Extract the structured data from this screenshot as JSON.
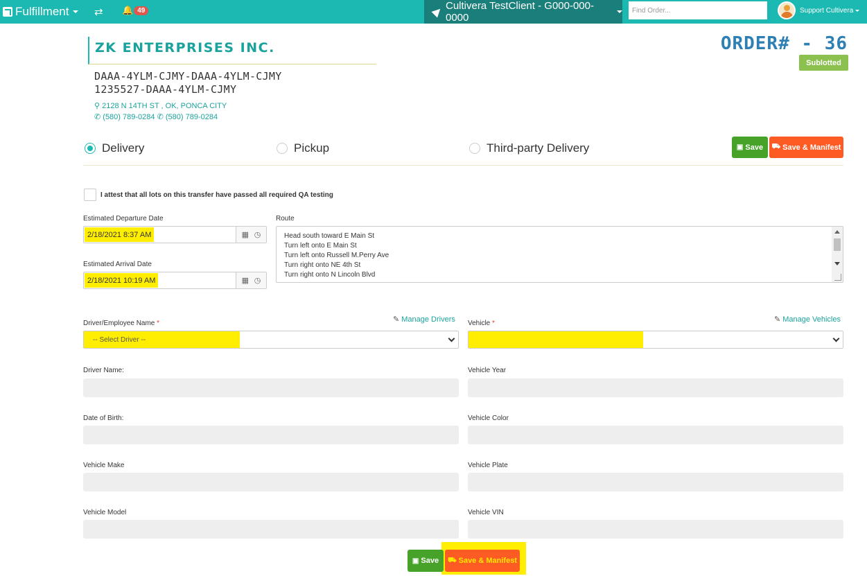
{
  "navbar": {
    "app_name": "Fulfillment",
    "notifications_count": "49",
    "client": "Cultivera TestClient - G000-000-0000",
    "search_placeholder": "Find Order...",
    "user_name": "Support Cultivera"
  },
  "header": {
    "company_name": "ZK ENTERPRISES INC.",
    "license_line_1": "DAAA-4YLM-CJMY-DAAA-4YLM-CJMY",
    "license_line_2": "1235527-DAAA-4YLM-CJMY",
    "address": "2128 N 14TH ST , OK, PONCA CITY",
    "phone_1": "(580) 789-0284",
    "phone_2": "(580) 789-0284",
    "order_number": "ORDER# - 36",
    "status": "Sublotted",
    "status_color": "#8cc04f"
  },
  "delivery_options": [
    {
      "label": "Delivery",
      "selected": true
    },
    {
      "label": "Pickup",
      "selected": false
    },
    {
      "label": "Third-party Delivery",
      "selected": false
    }
  ],
  "actions": {
    "save_label": "Save",
    "save_manifest_label": "Save & Manifest"
  },
  "attest_label": "I attest that all lots on this transfer have passed all required QA testing",
  "schedule": {
    "departure_label": "Estimated Departure Date",
    "departure_value": "2/18/2021 8:37 AM",
    "arrival_label": "Estimated Arrival Date",
    "arrival_value": "2/18/2021 10:19 AM",
    "route_label": "Route",
    "route_lines": [
      "Head south toward E Main St",
      "Turn left onto E Main St",
      "Turn left onto Russell M.Perry Ave",
      "Turn right onto NE 4th St",
      "Turn right onto N Lincoln Blvd"
    ]
  },
  "driver": {
    "label": "Driver/Employee Name",
    "required_mark": "*",
    "manage_label": "Manage Drivers",
    "select_value": "-- Select Driver --",
    "fields": [
      "Driver Name:",
      "Date of Birth:",
      "Vehicle Make",
      "Vehicle Model"
    ]
  },
  "vehicle": {
    "label": "Vehicle",
    "required_mark": "*",
    "manage_label": "Manage Vehicles",
    "select_value": "",
    "fields": [
      "Vehicle Year",
      "Vehicle Color",
      "Vehicle Plate",
      "Vehicle VIN"
    ]
  },
  "colors": {
    "primary": "#1bb9b1",
    "save": "#46a229",
    "manifest": "#fd5b24",
    "highlight": "#ffee00"
  }
}
